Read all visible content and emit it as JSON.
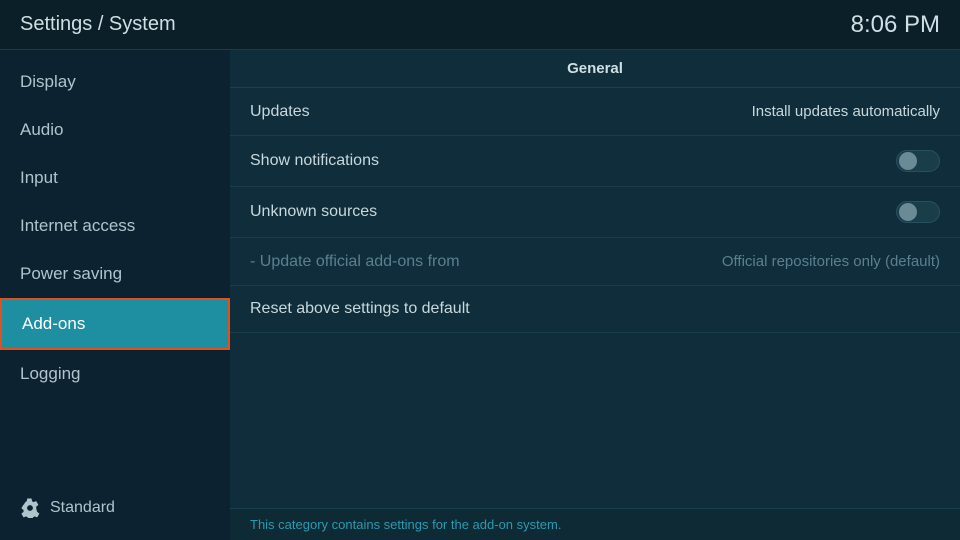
{
  "header": {
    "title": "Settings / System",
    "time": "8:06 PM"
  },
  "sidebar": {
    "items": [
      {
        "id": "display",
        "label": "Display",
        "active": false
      },
      {
        "id": "audio",
        "label": "Audio",
        "active": false
      },
      {
        "id": "input",
        "label": "Input",
        "active": false
      },
      {
        "id": "internet-access",
        "label": "Internet access",
        "active": false
      },
      {
        "id": "power-saving",
        "label": "Power saving",
        "active": false
      },
      {
        "id": "add-ons",
        "label": "Add-ons",
        "active": true
      },
      {
        "id": "logging",
        "label": "Logging",
        "active": false
      }
    ],
    "bottom_label": "Standard"
  },
  "content": {
    "section_title": "General",
    "settings": [
      {
        "id": "updates",
        "label": "Updates",
        "value": "Install updates automatically",
        "type": "text",
        "dimmed": false
      },
      {
        "id": "show-notifications",
        "label": "Show notifications",
        "value": "",
        "type": "toggle",
        "toggle_on": false,
        "dimmed": false
      },
      {
        "id": "unknown-sources",
        "label": "Unknown sources",
        "value": "",
        "type": "toggle",
        "toggle_on": false,
        "dimmed": false
      },
      {
        "id": "update-official",
        "label": "- Update official add-ons from",
        "value": "Official repositories only (default)",
        "type": "text",
        "dimmed": true
      }
    ],
    "reset_label": "Reset above settings to default",
    "footer_text": "This category contains settings for the add-on system."
  }
}
